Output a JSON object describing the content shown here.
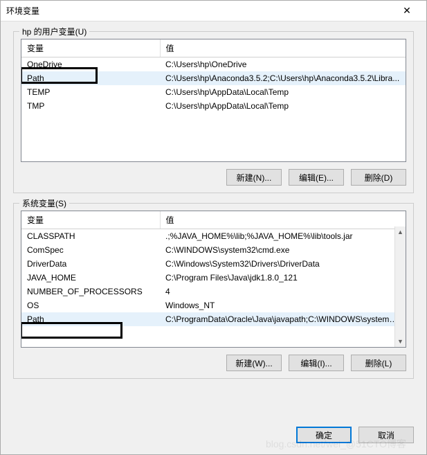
{
  "window": {
    "title": "环境变量",
    "close_glyph": "✕"
  },
  "user_section": {
    "label": "hp 的用户变量(U)",
    "headers": {
      "name": "变量",
      "value": "值"
    },
    "rows": [
      {
        "name": "OneDrive",
        "value": "C:\\Users\\hp\\OneDrive"
      },
      {
        "name": "Path",
        "value": "C:\\Users\\hp\\Anaconda3.5.2;C:\\Users\\hp\\Anaconda3.5.2\\Libra..."
      },
      {
        "name": "TEMP",
        "value": "C:\\Users\\hp\\AppData\\Local\\Temp"
      },
      {
        "name": "TMP",
        "value": "C:\\Users\\hp\\AppData\\Local\\Temp"
      }
    ],
    "buttons": {
      "new": "新建(N)...",
      "edit": "编辑(E)...",
      "delete": "删除(D)"
    }
  },
  "system_section": {
    "label": "系统变量(S)",
    "headers": {
      "name": "变量",
      "value": "值"
    },
    "rows": [
      {
        "name": "CLASSPATH",
        "value": ".;%JAVA_HOME%\\lib;%JAVA_HOME%\\lib\\tools.jar"
      },
      {
        "name": "ComSpec",
        "value": "C:\\WINDOWS\\system32\\cmd.exe"
      },
      {
        "name": "DriverData",
        "value": "C:\\Windows\\System32\\Drivers\\DriverData"
      },
      {
        "name": "JAVA_HOME",
        "value": "C:\\Program Files\\Java\\jdk1.8.0_121"
      },
      {
        "name": "NUMBER_OF_PROCESSORS",
        "value": "4"
      },
      {
        "name": "OS",
        "value": "Windows_NT"
      },
      {
        "name": "Path",
        "value": "C:\\ProgramData\\Oracle\\Java\\javapath;C:\\WINDOWS\\system3..."
      }
    ],
    "buttons": {
      "new": "新建(W)...",
      "edit": "编辑(I)...",
      "delete": "删除(L)"
    }
  },
  "footer": {
    "ok": "确定",
    "cancel": "取消"
  },
  "watermark": "blog.csdn.net/wei_@51CTO博客"
}
